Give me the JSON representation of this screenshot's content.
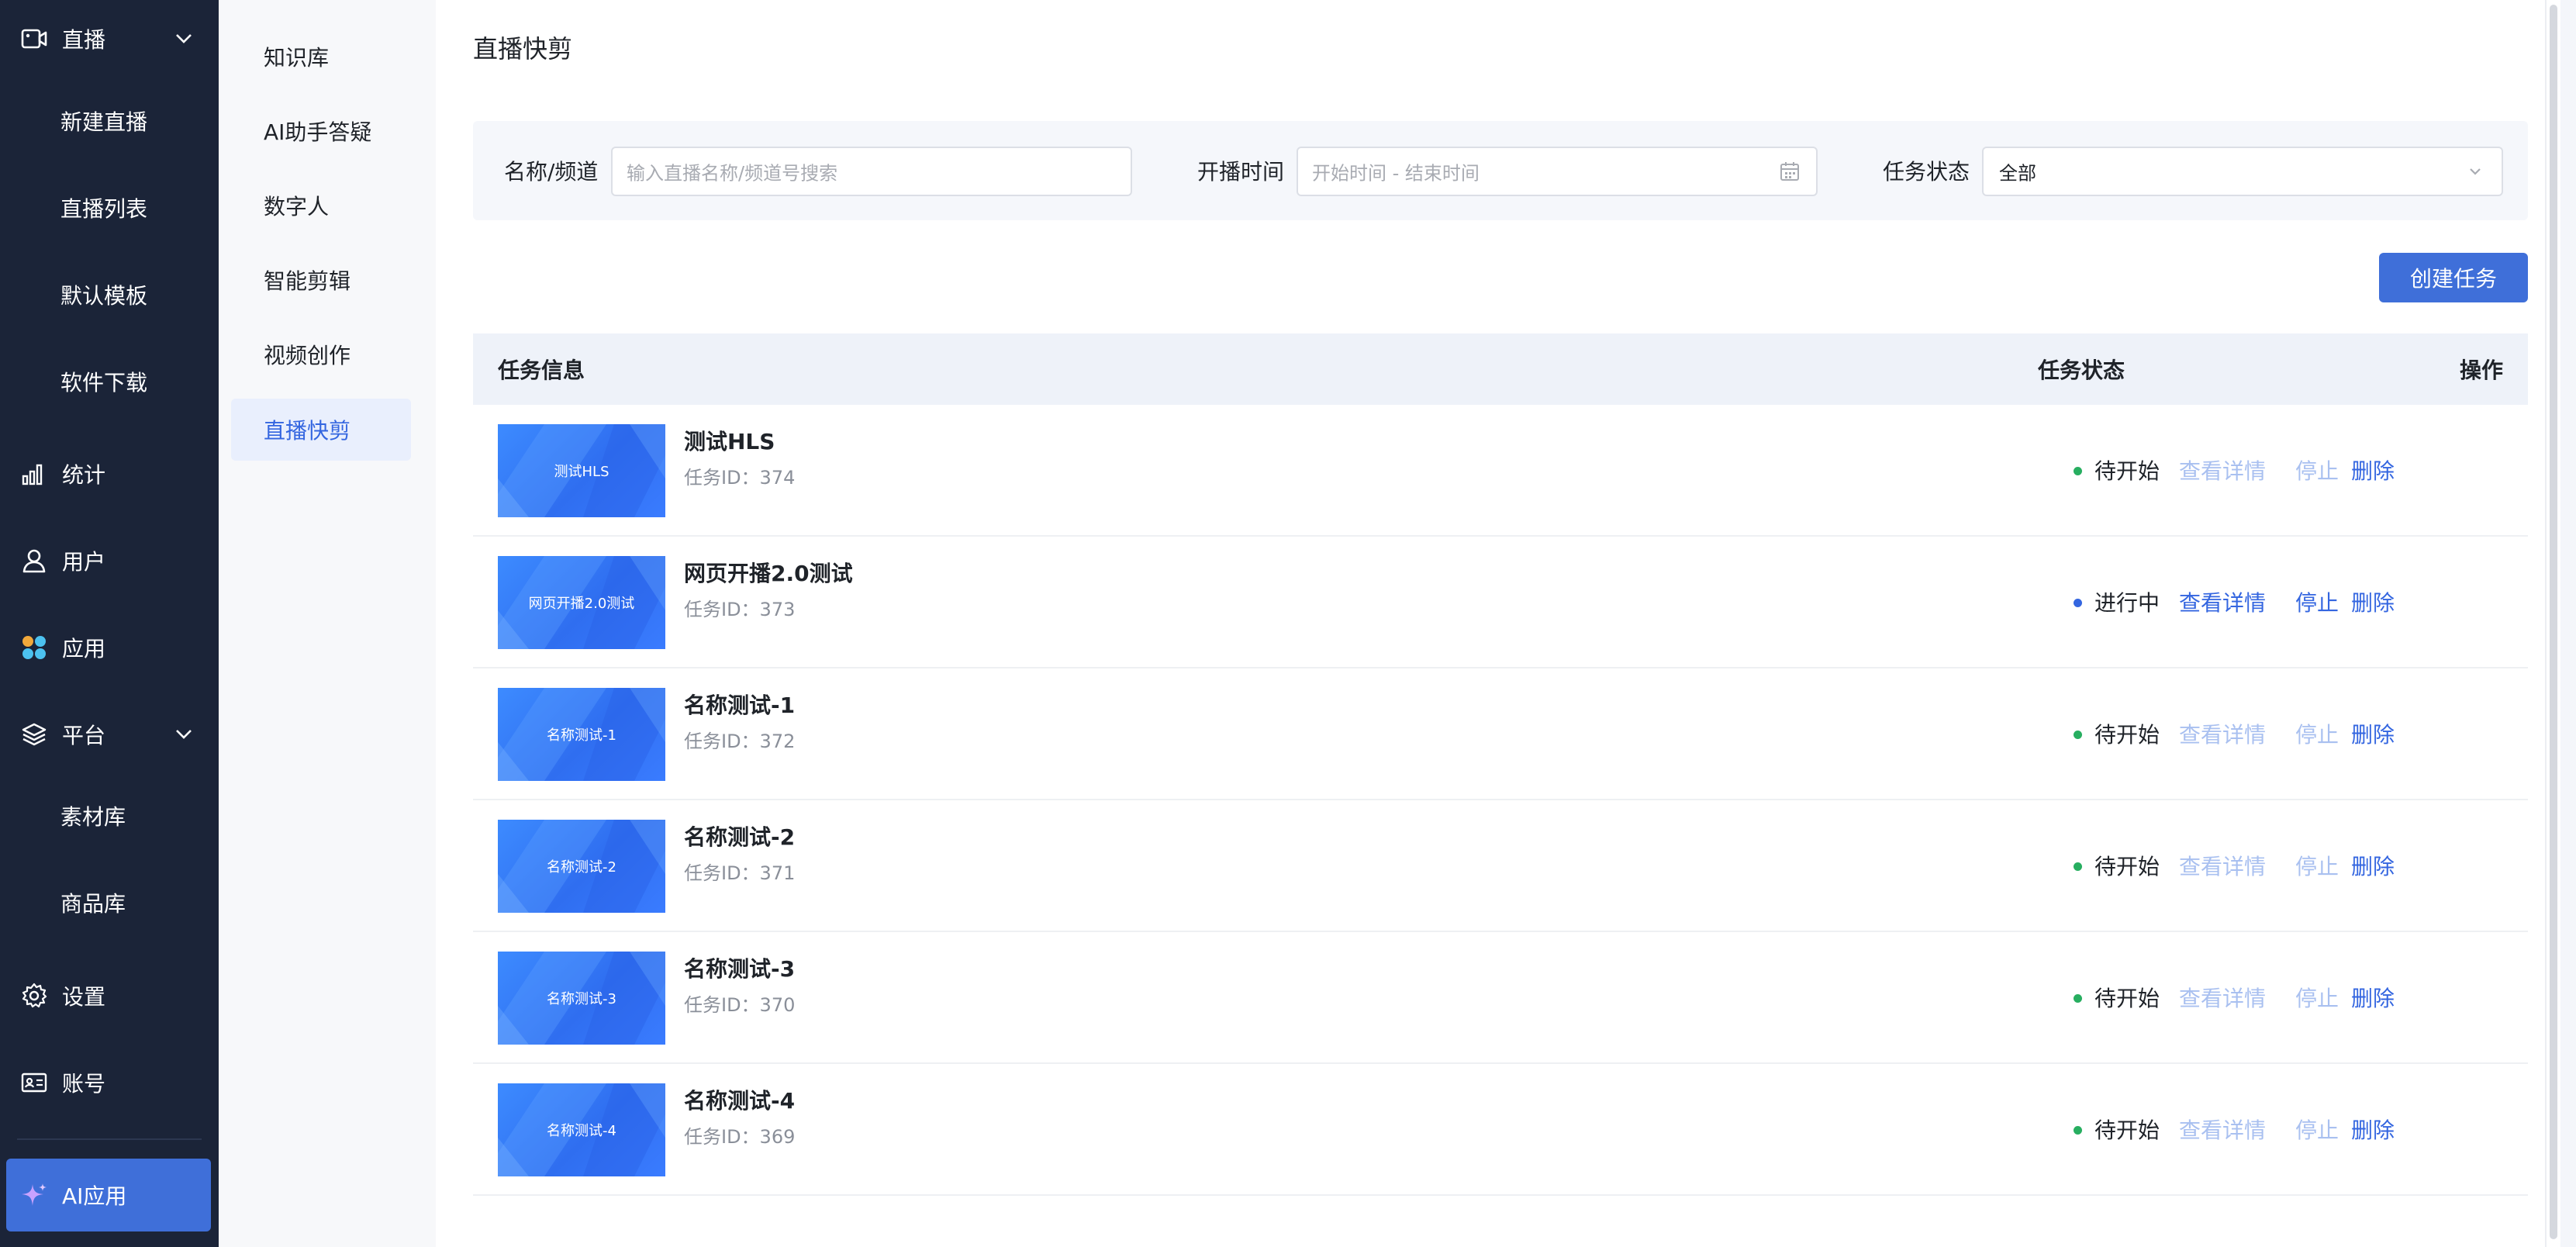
{
  "sidebar": {
    "live": {
      "label": "直播",
      "icon": "video-camera-icon"
    },
    "live_items": [
      {
        "label": "新建直播"
      },
      {
        "label": "直播列表"
      },
      {
        "label": "默认模板"
      },
      {
        "label": "软件下载"
      }
    ],
    "stats": {
      "label": "统计",
      "icon": "bar-chart-icon"
    },
    "users": {
      "label": "用户",
      "icon": "user-icon"
    },
    "apps": {
      "label": "应用",
      "icon": "apps-icon"
    },
    "platform": {
      "label": "平台",
      "icon": "layers-icon"
    },
    "platform_items": [
      {
        "label": "素材库"
      },
      {
        "label": "商品库"
      }
    ],
    "settings": {
      "label": "设置",
      "icon": "gear-icon"
    },
    "account": {
      "label": "账号",
      "icon": "id-card-icon"
    },
    "ai_app": {
      "label": "AI应用",
      "icon": "sparkle-icon"
    }
  },
  "submenu": {
    "items": [
      {
        "label": "知识库"
      },
      {
        "label": "AI助手答疑"
      },
      {
        "label": "数字人"
      },
      {
        "label": "智能剪辑"
      },
      {
        "label": "视频创作"
      },
      {
        "label": "直播快剪"
      }
    ],
    "active": "直播快剪"
  },
  "page": {
    "title": "直播快剪"
  },
  "filters": {
    "name_label": "名称/频道",
    "name_placeholder": "输入直播名称/频道号搜索",
    "time_label": "开播时间",
    "time_placeholder": "开始时间 - 结束时间",
    "status_label": "任务状态",
    "status_value": "全部"
  },
  "actions": {
    "create_label": "创建任务"
  },
  "table": {
    "headers": {
      "info": "任务信息",
      "status": "任务状态",
      "ops": "操作"
    },
    "rows": [
      {
        "thumb_text": "测试HLS",
        "name": "测试HLS",
        "id_text": "任务ID：374",
        "status": "待开始",
        "status_color": "#27ae60",
        "view": "查看详情",
        "stop": "停止",
        "del": "删除",
        "active": false
      },
      {
        "thumb_text": "网页开播2.0测试",
        "name": "网页开播2.0测试",
        "id_text": "任务ID：373",
        "status": "进行中",
        "status_color": "#3466e0",
        "view": "查看详情",
        "stop": "停止",
        "del": "删除",
        "active": true
      },
      {
        "thumb_text": "名称测试-1",
        "name": "名称测试-1",
        "id_text": "任务ID：372",
        "status": "待开始",
        "status_color": "#27ae60",
        "view": "查看详情",
        "stop": "停止",
        "del": "删除",
        "active": false
      },
      {
        "thumb_text": "名称测试-2",
        "name": "名称测试-2",
        "id_text": "任务ID：371",
        "status": "待开始",
        "status_color": "#27ae60",
        "view": "查看详情",
        "stop": "停止",
        "del": "删除",
        "active": false
      },
      {
        "thumb_text": "名称测试-3",
        "name": "名称测试-3",
        "id_text": "任务ID：370",
        "status": "待开始",
        "status_color": "#27ae60",
        "view": "查看详情",
        "stop": "停止",
        "del": "删除",
        "active": false
      },
      {
        "thumb_text": "名称测试-4",
        "name": "名称测试-4",
        "id_text": "任务ID：369",
        "status": "待开始",
        "status_color": "#27ae60",
        "view": "查看详情",
        "stop": "停止",
        "del": "删除",
        "active": false
      }
    ]
  },
  "colors": {
    "sidebar_bg": "#1b2438",
    "accent": "#3f6fd9",
    "link": "#3466e0",
    "link_disabled": "#a9c0f0",
    "pending": "#27ae60"
  }
}
